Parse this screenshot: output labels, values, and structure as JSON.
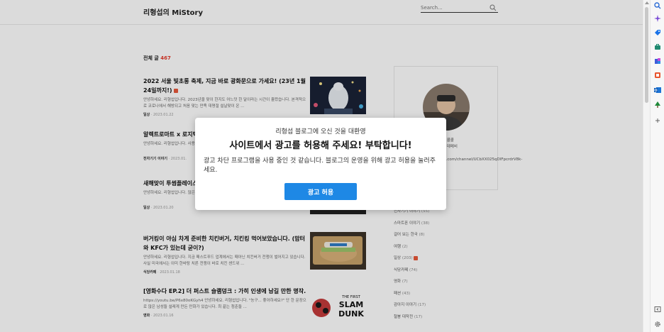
{
  "header": {
    "blog_title": "리형섭의 MiStory",
    "search_placeholder": "Search..."
  },
  "listing": {
    "total_label": "전체 글",
    "total_count": "467"
  },
  "posts": [
    {
      "title": "2022 서울 빛초롱 축제, 지금 바로 광화문으로 가세요! (23년 1월 24일까지!)",
      "desc": "안녕하세요. 리형섭입니다. 2023년을 맞이 한지도 어느덧 한 달이라는 시간이 흘렀습니다. 본격적으로 코로나에서 해방되고 처음 맞는 만족 대명절 설날맞이 온 ...",
      "category": "일상",
      "date": "2023.01.22"
    },
    {
      "title": "알렉트로마트 x 로지텍",
      "desc": "안녕하세요. 리형섭입니다. 사용하고 있는데요. 예전에",
      "category": "전자기기 이야기",
      "date": "2023.01."
    },
    {
      "title": "새해맞이 투썸플레이스 (투썸 데일리 미니 조명",
      "desc": "안녕하세요. 리형섭입니다. 많은 회사들이 이벤트를 진행",
      "category": "일상",
      "date": "2023.01.20"
    },
    {
      "title": "버거킹이 야심 차게 준비한 치킨버거, 치킨킹 먹어보았습니다. (맘터와 KFC가 있는데 굳이?)",
      "desc": "안녕하세요. 리형섭입니다. 지금 패스트푸드 업계에서는 때아닌 치킨버거 전쟁이 벌어지고 있습니다. 사실 미국에서는 이미 한바탕 치른 전쟁이 바로 치킨 샌드위 ...",
      "category": "식당카페",
      "date": "2023.01.18"
    },
    {
      "title": "[영화수다 EP.2] 더 퍼스트 슬램덩크 : 가히 인생에 남길 만한 명작.",
      "desc": "https://youtu.be/P6x80oKGyh4 안녕하세요. 리형섭입니다. \"농구... 좋아하세요?\" 단 한 문장으로 많은 남성들 설레게 만든 만화가 있습니다. 최 끝는 청춘들 ...",
      "category": "영화",
      "date": "2023.01.16"
    }
  ],
  "thumb5": {
    "line1": "THE FIRST",
    "line2": "SLAM",
    "line3": "DUNK"
  },
  "profile": {
    "text_lines": [
      "니다. 시시콜콜",
      "학합니다. 데메비",
      "튜브 채널",
      "youtube.com/channel/UCbXX025qDIFpcrdrV8k-",
      "QQ"
    ]
  },
  "categories": [
    {
      "name": "전자기기 이야기",
      "count": "(55)"
    },
    {
      "name": "스마트폰 이야기",
      "count": "(38)"
    },
    {
      "name": "걸어 보는 한국",
      "count": "(8)"
    },
    {
      "name": "여행",
      "count": "(2)"
    },
    {
      "name": "일상",
      "count": "(203)"
    },
    {
      "name": "식당카페",
      "count": "(74)"
    },
    {
      "name": "영화",
      "count": "(7)"
    },
    {
      "name": "패션",
      "count": "(43)"
    },
    {
      "name": "감아지 이야기",
      "count": "(17)"
    },
    {
      "name": "철봉 대작전",
      "count": "(17)"
    }
  ],
  "modal": {
    "welcome": "리형섭 블로그에 오신 것을 대환영",
    "headline": "사이트에서 광고를 허용해 주세요! 부탁합니다!",
    "body": "광고 차단 프로그램을 사용 중인 것 같습니다. 블로그의 운영을 위해 광고 허용을 눌러주세요.",
    "button": "광고 허용"
  },
  "colors": {
    "accent_red": "#e53a2a",
    "button_blue": "#1e88e5"
  }
}
